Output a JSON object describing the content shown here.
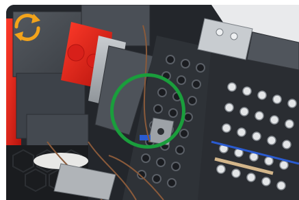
{
  "image": {
    "alt": "",
    "subject": "lego-technic-panel-closeup"
  },
  "controls": {
    "rotate_icon": "rotate-arrows-icon",
    "rotate_color": "#f2a31b"
  },
  "highlight": {
    "color": "#1a9e3c"
  },
  "colors": {
    "brick_dark": "#3a3f47",
    "brick_mid": "#4b5058",
    "brick_red": "#e0201a",
    "frame_bg": "#1c1f24",
    "wire": "#8a5a3a"
  }
}
